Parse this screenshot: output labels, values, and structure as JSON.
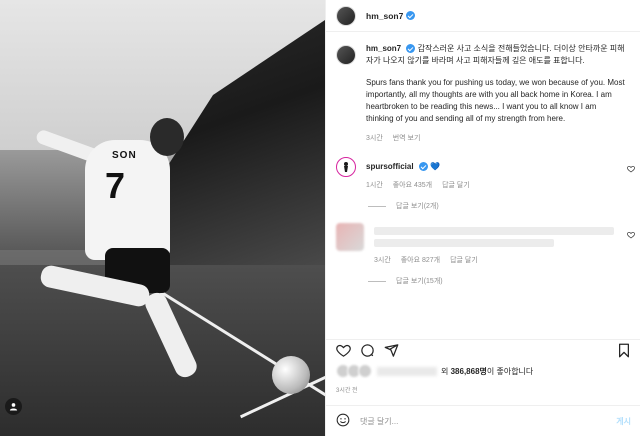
{
  "photo": {
    "jersey_name": "SON",
    "jersey_number": "7"
  },
  "header": {
    "username": "hm_son7"
  },
  "caption": {
    "username": "hm_son7",
    "korean_text": "갑작스러운 사고 소식을 전해들었습니다. 더이상 안타까운 피해자가 나오지 않기를 바라며 사고 피해자들께 깊은 애도를 표합니다.",
    "english_text": "Spurs fans thank you for pushing us today, we won because of you. Most importantly, all my thoughts are with you all back home in Korea. I am heartbroken to be reading this news... I want you to all know I am thinking of you and sending all of my strength from here.",
    "time": "3시간",
    "translate": "번역 보기"
  },
  "comments": [
    {
      "username": "spursofficial",
      "text": "💙",
      "time": "1시간",
      "likes": "좋아요 435개",
      "reply": "답글 달기",
      "view_replies": "답글 보기(2개)"
    },
    {
      "time": "3시간",
      "likes": "좋아요 827개",
      "reply": "답글 달기",
      "view_replies": "답글 보기(15개)"
    }
  ],
  "likes": {
    "prefix": "외",
    "count": "386,868명",
    "suffix": "이 좋아합니다"
  },
  "post_time": "3시간 전",
  "add_comment": {
    "placeholder": "댓글 달기...",
    "post_label": "게시"
  },
  "icons": {
    "like": "heart-icon",
    "comment": "comment-icon",
    "share": "share-icon",
    "save": "bookmark-icon",
    "emoji": "emoji-icon",
    "user_tag": "user-tag-icon"
  },
  "colors": {
    "verified": "#3897f0",
    "post_button": "#b2dffc",
    "secondary_text": "#8e8e8e"
  }
}
